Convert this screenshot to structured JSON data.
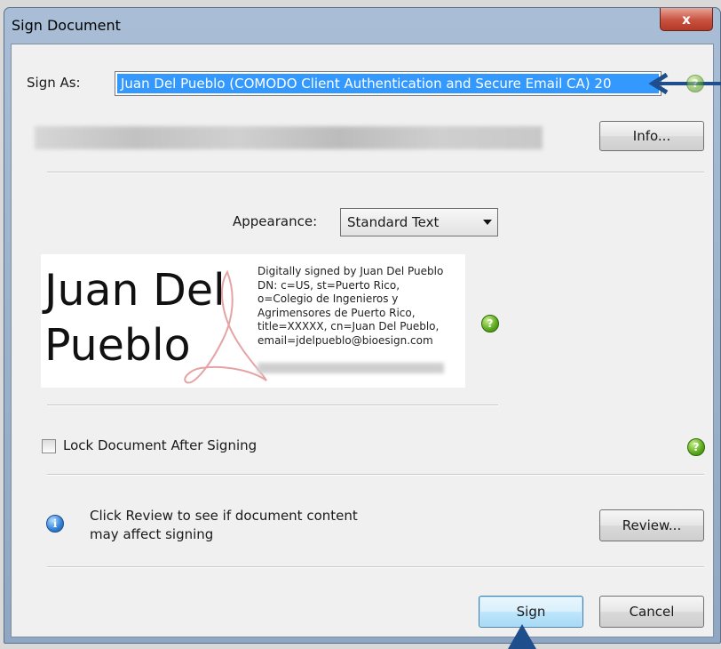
{
  "window": {
    "title": "Sign Document",
    "close_label": "x"
  },
  "sign_as": {
    "label": "Sign As:",
    "value": "Juan Del Pueblo (COMODO Client Authentication and Secure Email CA) 20"
  },
  "info_button": "Info...",
  "appearance": {
    "label": "Appearance:",
    "selected": "Standard Text"
  },
  "signature_preview": {
    "name_line1": "Juan Del",
    "name_line2": "Pueblo",
    "details": [
      "Digitally signed by Juan Del Pueblo",
      "DN: c=US, st=Puerto Rico,",
      "o=Colegio de Ingenieros y",
      "Agrimensores de Puerto Rico,",
      "title=XXXXX, cn=Juan Del Pueblo,",
      "email=jdelpueblo@bioesign.com"
    ]
  },
  "lock_document": {
    "label": "Lock Document After Signing",
    "checked": false
  },
  "review": {
    "line1": "Click Review to see if document content",
    "line2": "may affect signing",
    "button": "Review..."
  },
  "buttons": {
    "sign": "Sign",
    "cancel": "Cancel"
  },
  "icons": {
    "help": "help-icon",
    "info": "info-icon"
  },
  "colors": {
    "selection": "#3399ff",
    "arrow": "#1f4e8c",
    "help_green": "#59a81a"
  }
}
